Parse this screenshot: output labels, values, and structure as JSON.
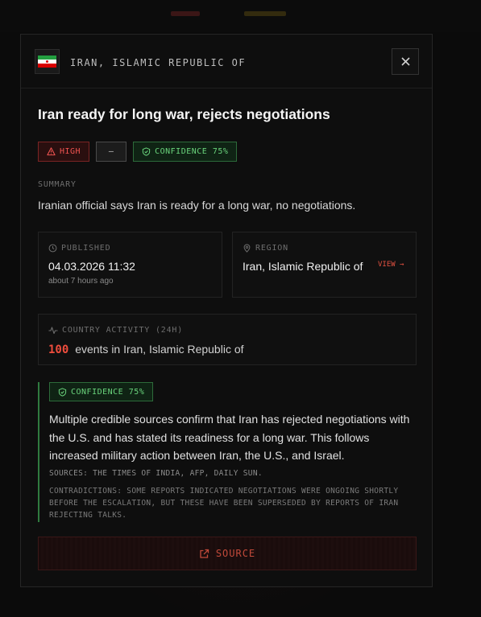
{
  "colors": {
    "accent_red": "#ef4d3d",
    "confidence_green": "#6ad47c",
    "high_red": "#ef5350"
  },
  "header": {
    "flag_icon": "iran-flag-icon",
    "country": "IRAN, ISLAMIC REPUBLIC OF",
    "close_icon": "close-icon"
  },
  "event": {
    "headline": "Iran ready for long war, rejects negotiations",
    "badges": {
      "severity": "HIGH",
      "severity_icon": "warning-triangle-icon",
      "secondary": "—",
      "confidence": "CONFIDENCE 75%",
      "confidence_icon": "shield-check-icon"
    },
    "summary_label": "SUMMARY",
    "summary": "Iranian official says Iran is ready for a long war, no negotiations."
  },
  "published": {
    "label": "PUBLISHED",
    "icon": "clock-icon",
    "datetime": "04.03.2026 11:32",
    "relative": "about 7 hours ago"
  },
  "region": {
    "label": "REGION",
    "icon": "map-pin-icon",
    "value": "Iran, Islamic Republic of",
    "view_link": "VIEW →"
  },
  "activity": {
    "label": "COUNTRY ACTIVITY (24H)",
    "icon": "activity-pulse-icon",
    "count": "100",
    "text": "events in Iran, Islamic Republic of"
  },
  "analysis": {
    "confidence": "CONFIDENCE 75%",
    "body": "Multiple credible sources confirm that Iran has rejected negotiations with the U.S. and has stated its readiness for a long war. This follows increased military action between Iran, the U.S., and Israel.",
    "sources": "SOURCES: THE TIMES OF INDIA, AFP, DAILY SUN.",
    "contradictions": "CONTRADICTIONS: SOME REPORTS INDICATED NEGOTIATIONS WERE ONGOING SHORTLY BEFORE THE ESCALATION, BUT THESE HAVE BEEN SUPERSEDED BY REPORTS OF IRAN REJECTING TALKS."
  },
  "source_button": {
    "label": "SOURCE",
    "icon": "external-link-icon"
  }
}
